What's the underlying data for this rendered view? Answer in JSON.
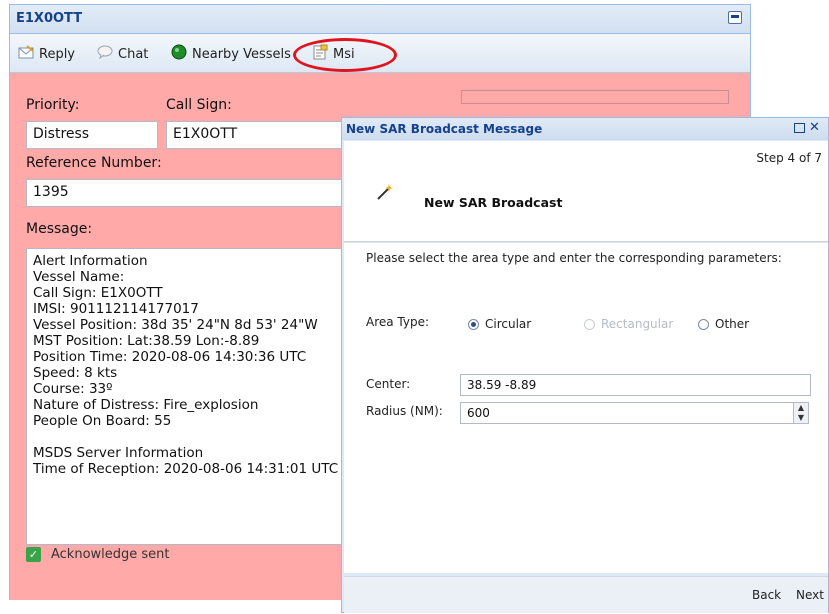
{
  "window": {
    "title": "E1X0OTT"
  },
  "toolbar": {
    "reply": "Reply",
    "chat": "Chat",
    "nearby": "Nearby Vessels",
    "msi": "Msi"
  },
  "form": {
    "priority_label": "Priority:",
    "priority_value": "Distress",
    "callsign_label": "Call Sign:",
    "callsign_value": "E1X0OTT",
    "ref_label": "Reference Number:",
    "ref_value": "1395",
    "message_label": "Message:",
    "message_lines": [
      "Alert Information",
      "Vessel Name:",
      "Call Sign: E1X0OTT",
      "IMSI: 901112114177017",
      "Vessel Position: 38d 35' 24\"N 8d 53' 24\"W",
      "MST Position: Lat:38.59 Lon:-8.89",
      "Position Time: 2020-08-06 14:30:36 UTC",
      "Speed: 8 kts",
      "Course: 33º",
      "Nature of Distress: Fire_explosion",
      "People On Board: 55",
      "",
      "MSDS Server Information",
      "Time of Reception: 2020-08-06 14:31:01 UTC"
    ],
    "ack": "Acknowledge sent"
  },
  "dialog": {
    "title": "New SAR Broadcast Message",
    "heading": "New SAR Broadcast",
    "step": "Step 4 of 7",
    "instruction": "Please select the area type and enter the corresponding parameters:",
    "area_type_label": "Area Type:",
    "options": [
      "Circular",
      "Rectangular",
      "Other"
    ],
    "selected_option": "Circular",
    "center_label": "Center:",
    "center_value": "38.59 -8.89",
    "radius_label": "Radius (NM):",
    "radius_value": "600",
    "back": "Back",
    "next": "Next"
  },
  "colors": {
    "form_bg": "#ffa9a9",
    "highlight": "#e0141e",
    "title_text": "#15428b"
  }
}
